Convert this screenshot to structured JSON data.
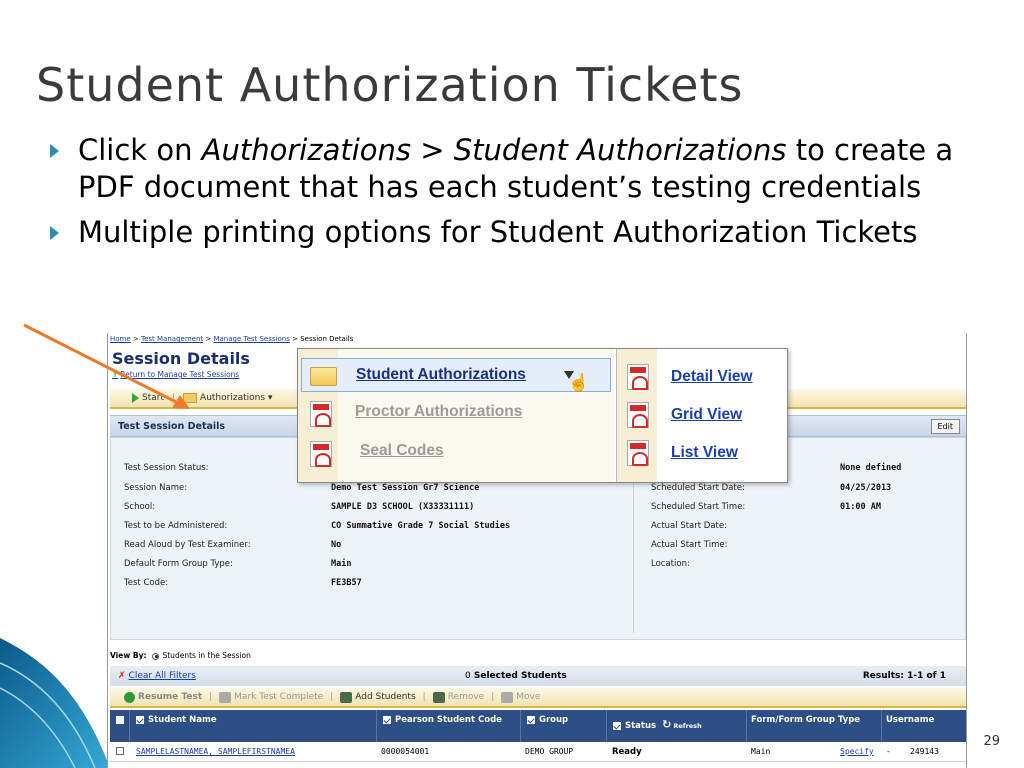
{
  "slide": {
    "title": "Student Authorization Tickets",
    "bullet1": {
      "pre": "Click on ",
      "em1": "Authorizations",
      "mid": " > ",
      "em2": "Student Authorizations",
      "post": " to create a PDF document that has each student’s testing credentials"
    },
    "bullet2": "Multiple printing options for Student Authorization Tickets",
    "page_number": "29",
    "accent_color": "#2a8fb6",
    "arrow_color": "#f07a2a"
  },
  "screenshot": {
    "breadcrumb": {
      "home": "Home",
      "sep1": " > ",
      "test_management": "Test Management",
      "sep2": " > ",
      "manage_sessions": "Manage Test Sessions",
      "sep3": " > ",
      "current": "Session Details"
    },
    "page_title": "Session Details",
    "return_link": "Return to Manage Test Sessions",
    "toolbar": {
      "start": "Start",
      "authorizations": "Authorizations ▾"
    },
    "details_header": "Test Session Details",
    "edit_label": "Edit",
    "fields_left": [
      {
        "label": "Test Session Status:",
        "value": ""
      },
      {
        "label": "Session Name:",
        "value": "Demo Test Session Gr7 Science"
      },
      {
        "label": "School:",
        "value": "SAMPLE D3 SCHOOL (X33331111)"
      },
      {
        "label": "Test to be Administered:",
        "value": "CO Summative Grade 7 Social Studies"
      },
      {
        "label": "Read Aloud by Test Examiner:",
        "value": "No"
      },
      {
        "label": "Default Form Group Type:",
        "value": "Main"
      },
      {
        "label": "Test Code:",
        "value": "FE3B57"
      }
    ],
    "fields_right": [
      {
        "label": "",
        "value": "None defined"
      },
      {
        "label": "Scheduled Start Date:",
        "value": "04/25/2013"
      },
      {
        "label": "Scheduled Start Time:",
        "value": "01:00 AM"
      },
      {
        "label": "Actual Start Date:",
        "value": ""
      },
      {
        "label": "Actual Start Time:",
        "value": ""
      },
      {
        "label": "Location:",
        "value": ""
      }
    ],
    "view_by": {
      "label": "View By:",
      "option": "Students in the Session"
    },
    "filter_bar": {
      "clear": "Clear All Filters",
      "selected_count": "0",
      "selected_label": "Selected Students",
      "results": "Results: 1-1 of 1"
    },
    "toolbar2": {
      "resume": "Resume Test",
      "mark_complete": "Mark Test Complete",
      "add_students": "Add Students",
      "remove": "Remove",
      "move": "Move"
    },
    "table": {
      "columns": [
        "Student Name",
        "Pearson Student Code",
        "Group",
        "Status",
        "Refresh",
        "Form/Form Group Type",
        "Username"
      ],
      "rows": [
        {
          "name": "SAMPLELASTNAMEA, SAMPLEFIRSTNAMEA",
          "code": "0000054001",
          "group": "DEMO GROUP",
          "status": "Ready",
          "form": "Main",
          "specify": "Specify",
          "dash": "-",
          "username": "249143"
        }
      ]
    },
    "popup": {
      "student_auth": "Student Authorizations",
      "proctor_auth": "Proctor Authorizations",
      "seal_codes": "Seal Codes",
      "detail_view": "Detail View",
      "grid_view": "Grid View",
      "list_view": "List View"
    }
  }
}
